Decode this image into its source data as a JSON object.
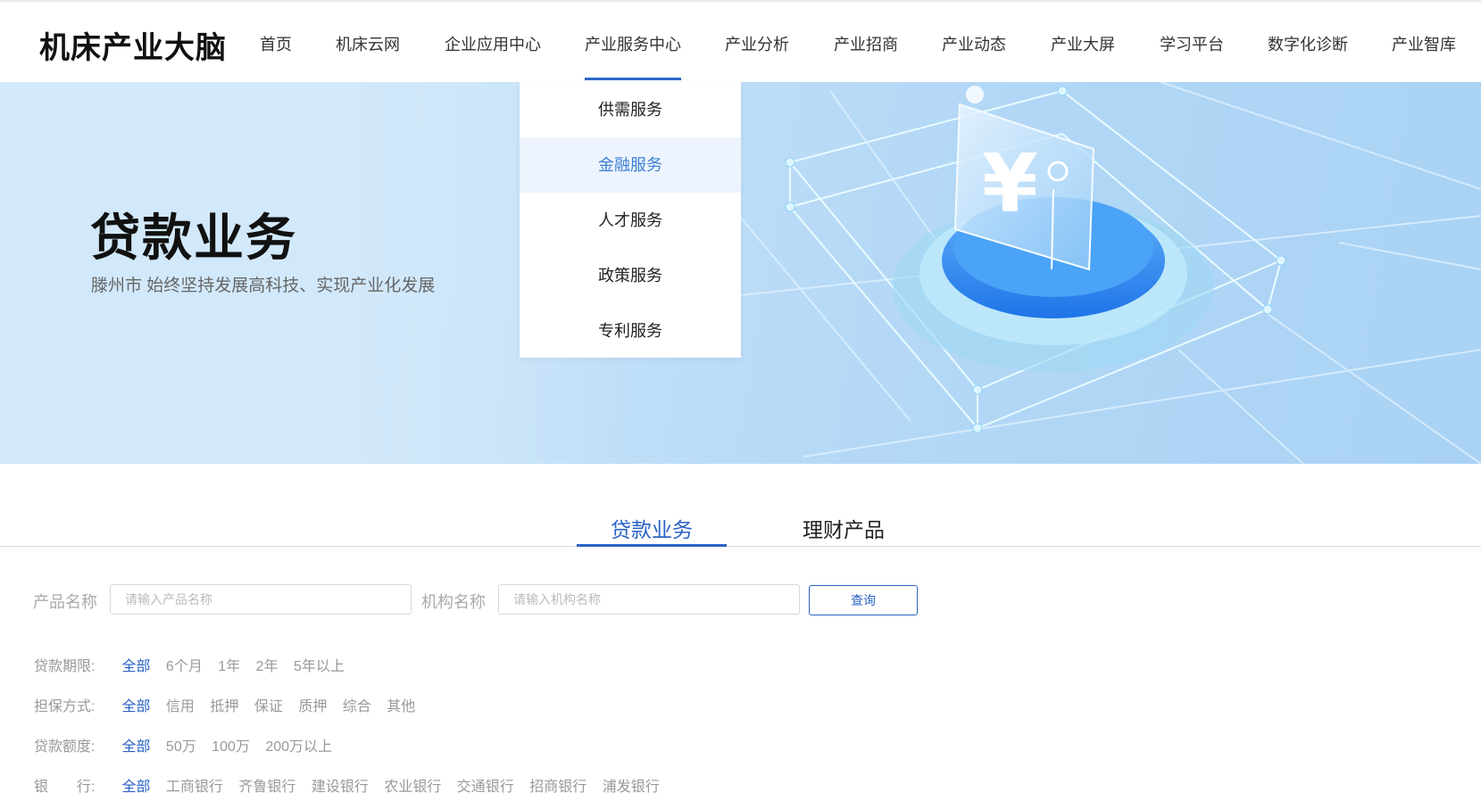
{
  "header": {
    "logo": "机床产业大脑",
    "nav": [
      "首页",
      "机床云网",
      "企业应用中心",
      "产业服务中心",
      "产业分析",
      "产业招商",
      "产业动态",
      "产业大屏",
      "学习平台",
      "数字化诊断",
      "产业智库"
    ]
  },
  "dropdown": {
    "items": [
      "供需服务",
      "金融服务",
      "人才服务",
      "政策服务",
      "专利服务"
    ],
    "active_index": 1
  },
  "banner": {
    "title": "贷款业务",
    "subtitle": "滕州市 始终坚持发展高科技、实现产业化发展",
    "symbol": "¥"
  },
  "tabs": [
    "贷款业务",
    "理财产品"
  ],
  "search": {
    "product_label": "产品名称",
    "product_placeholder": "请输入产品名称",
    "org_label": "机构名称",
    "org_placeholder": "请输入机构名称",
    "button": "查询"
  },
  "filters": [
    {
      "label": "贷款期限:",
      "options": [
        "全部",
        "6个月",
        "1年",
        "2年",
        "5年以上"
      ]
    },
    {
      "label": "担保方式:",
      "options": [
        "全部",
        "信用",
        "抵押",
        "保证",
        "质押",
        "综合",
        "其他"
      ]
    },
    {
      "label": "贷款额度:",
      "options": [
        "全部",
        "50万",
        "100万",
        "200万以上"
      ]
    },
    {
      "label": "银　　行:",
      "options": [
        "全部",
        "工商银行",
        "齐鲁银行",
        "建设银行",
        "农业银行",
        "交通银行",
        "招商银行",
        "浦发银行"
      ]
    }
  ],
  "colors": {
    "accent": "#2a62c4",
    "dropdown_active_bg": "#edf4fd",
    "banner_bg": "#c6e2f8"
  },
  "icons": {
    "banner_illustration": "yuan-coin-icon"
  }
}
